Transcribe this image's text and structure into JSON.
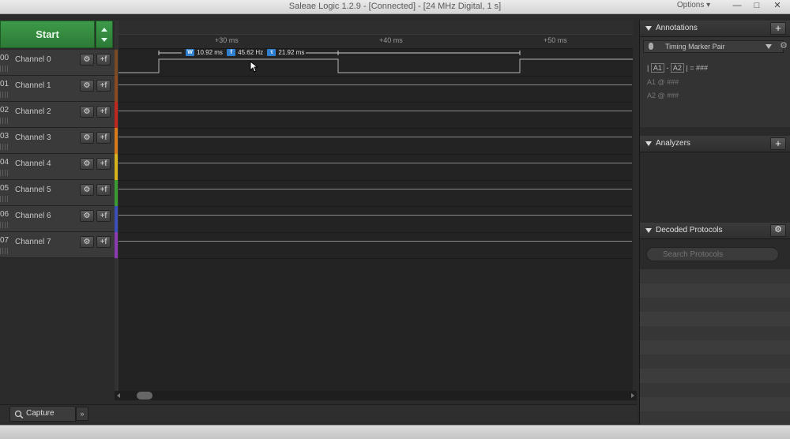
{
  "window": {
    "title": "Saleae Logic 1.2.9 - [Connected] - [24 MHz Digital, 1 s]",
    "options_label": "Options ▾",
    "minimize": "—",
    "restore": "□",
    "close": "✕"
  },
  "toolbar": {
    "start_label": "Start"
  },
  "timeline": {
    "ticks": [
      "+30 ms",
      "+40 ms",
      "+50 ms"
    ]
  },
  "measurement": {
    "width": "10.92 ms",
    "frequency": "45.62 Hz",
    "period": "21.92 ms",
    "w_badge": "W",
    "f_badge": "f",
    "t_badge": "τ"
  },
  "channels": [
    {
      "num": "00",
      "name": "Channel 0",
      "color": "#7a4a22"
    },
    {
      "num": "01",
      "name": "Channel 1",
      "color": "#8a4a1f"
    },
    {
      "num": "02",
      "name": "Channel 2",
      "color": "#c0271e"
    },
    {
      "num": "03",
      "name": "Channel 3",
      "color": "#d77a1c"
    },
    {
      "num": "04",
      "name": "Channel 4",
      "color": "#d6b21d"
    },
    {
      "num": "05",
      "name": "Channel 5",
      "color": "#3c9a35"
    },
    {
      "num": "06",
      "name": "Channel 6",
      "color": "#3a4fb8"
    },
    {
      "num": "07",
      "name": "Channel 7",
      "color": "#8a3bb0"
    }
  ],
  "channel_buttons": {
    "settings": "⚙",
    "trigger": "+f"
  },
  "annotations": {
    "header": "Annotations",
    "marker_type": "Timing Marker Pair",
    "line1_a1": "A1",
    "line1_a2": "A2",
    "line1_value": "= ###",
    "line2": "A1  @  ###",
    "line3": "A2  @  ###",
    "plus": "+"
  },
  "analyzers": {
    "header": "Analyzers",
    "plus": "+"
  },
  "decoded": {
    "header": "Decoded Protocols",
    "search_placeholder": "Search Protocols"
  },
  "bottom": {
    "capture_tab": "Capture",
    "more_tab": "»"
  }
}
